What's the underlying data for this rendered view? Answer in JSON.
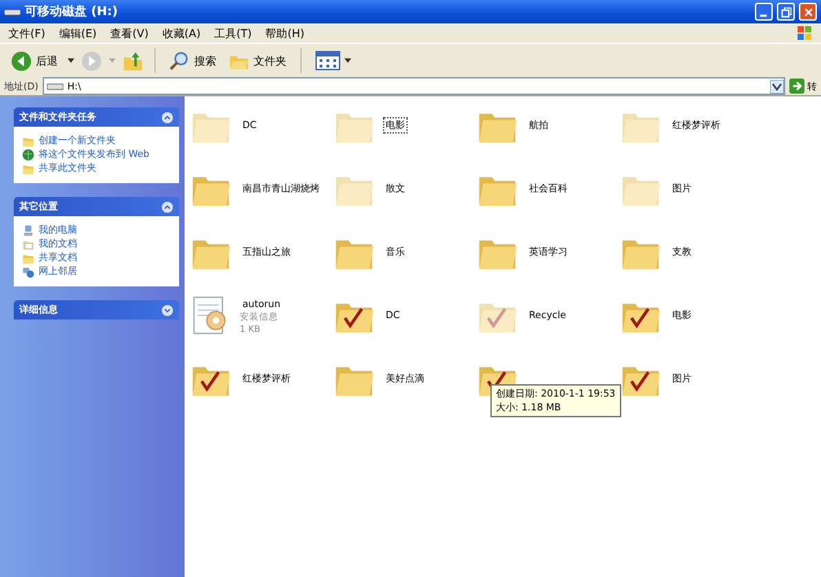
{
  "window": {
    "title": "可移动磁盘 (H:)"
  },
  "menu": [
    "文件(F)",
    "编辑(E)",
    "查看(V)",
    "收藏(A)",
    "工具(T)",
    "帮助(H)"
  ],
  "toolbar": {
    "back": "后退",
    "search": "搜索",
    "folders": "文件夹"
  },
  "address": {
    "label": "地址(D)",
    "value": "H:\\",
    "go": "转"
  },
  "sidebar": [
    {
      "title": "文件和文件夹任务",
      "expanded": true,
      "items": [
        {
          "label": "创建一个新文件夹"
        },
        {
          "label": "将这个文件夹发布到 Web"
        },
        {
          "label": "共享此文件夹"
        }
      ]
    },
    {
      "title": "其它位置",
      "expanded": true,
      "items": [
        {
          "label": "我的电脑"
        },
        {
          "label": "我的文档"
        },
        {
          "label": "共享文档"
        },
        {
          "label": "网上邻居"
        }
      ]
    },
    {
      "title": "详细信息",
      "expanded": false
    }
  ],
  "files": [
    {
      "kind": "folder",
      "name": "DC",
      "hidden": true,
      "selected": false
    },
    {
      "kind": "folder",
      "name": "电影",
      "hidden": true,
      "selected": true
    },
    {
      "kind": "folder",
      "name": "航拍",
      "hidden": false,
      "selected": false
    },
    {
      "kind": "folder",
      "name": "红楼梦评析",
      "hidden": true,
      "selected": false
    },
    {
      "kind": "folder",
      "name": "南昌市青山湖烧烤",
      "hidden": false,
      "selected": false
    },
    {
      "kind": "folder",
      "name": "散文",
      "hidden": true,
      "selected": false
    },
    {
      "kind": "folder",
      "name": "社会百科",
      "hidden": false,
      "selected": false
    },
    {
      "kind": "folder",
      "name": "图片",
      "hidden": true,
      "selected": false
    },
    {
      "kind": "folder",
      "name": "五指山之旅",
      "hidden": false,
      "selected": false
    },
    {
      "kind": "folder",
      "name": "音乐",
      "hidden": false,
      "selected": false
    },
    {
      "kind": "folder",
      "name": "英语学习",
      "hidden": false,
      "selected": false
    },
    {
      "kind": "folder",
      "name": "支教",
      "hidden": false,
      "selected": false
    },
    {
      "kind": "file",
      "name": "autorun",
      "type": "安装信息",
      "size": "1 KB",
      "hidden": false,
      "selected": false
    },
    {
      "kind": "checked",
      "name": "DC",
      "hidden": false,
      "selected": false
    },
    {
      "kind": "checked",
      "name": "Recycle",
      "hidden": true,
      "selected": false
    },
    {
      "kind": "checked",
      "name": "电影",
      "hidden": false,
      "selected": false
    },
    {
      "kind": "checked",
      "name": "红楼梦评析",
      "hidden": false,
      "selected": false
    },
    {
      "kind": "folder",
      "name": "美好点滴",
      "hidden": false,
      "selected": false
    },
    {
      "kind": "checked",
      "hidden": false
    },
    {
      "kind": "checked",
      "name": "图片",
      "hidden": false,
      "selected": false
    }
  ],
  "tooltip": {
    "lines": [
      "创建日期: 2010-1-1 19:53",
      "大小: 1.18 MB"
    ]
  }
}
